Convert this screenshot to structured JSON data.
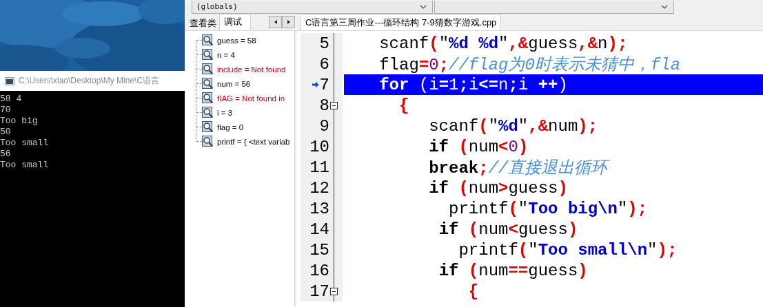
{
  "console": {
    "title": "C:\\Users\\xiao\\Desktop\\My Mine\\C语言",
    "lines": [
      "58 4",
      "70",
      "Too big",
      "50",
      "Too small",
      "56",
      "Too small"
    ]
  },
  "toolbar": {
    "scope": "(globals)"
  },
  "panel_tabs": [
    {
      "label": "查看类",
      "selected": false
    },
    {
      "label": "调试",
      "selected": true
    }
  ],
  "watch_items": [
    {
      "text": "guess = 58",
      "color": "#000000"
    },
    {
      "text": "n = 4",
      "color": "#000000"
    },
    {
      "text": "include = Not found",
      "color": "#d0021b"
    },
    {
      "text": "num = 56",
      "color": "#000000"
    },
    {
      "text": "fIAG = Not found in",
      "color": "#d0021b"
    },
    {
      "text": "i = 3",
      "color": "#000000"
    },
    {
      "text": "flag = 0",
      "color": "#000000"
    },
    {
      "text": "printf = { <text variab",
      "color": "#000000"
    }
  ],
  "editor_tabs": [
    {
      "label": "C语言第三周作业---循环结构 7-9猜数字游戏.cpp",
      "selected": true
    }
  ],
  "code_lines": [
    {
      "number": "5",
      "current": false,
      "foldable": false,
      "tokens": [
        {
          "text": "   scanf",
          "kind": "plain"
        },
        {
          "text": "(",
          "kind": "sym"
        },
        {
          "text": "\"",
          "kind": "plain"
        },
        {
          "text": "%d %d",
          "kind": "str"
        },
        {
          "text": "\"",
          "kind": "plain"
        },
        {
          "text": ",&",
          "kind": "sym"
        },
        {
          "text": "guess",
          "kind": "plain"
        },
        {
          "text": ",&",
          "kind": "sym"
        },
        {
          "text": "n",
          "kind": "plain"
        },
        {
          "text": ");",
          "kind": "sym"
        }
      ]
    },
    {
      "number": "6",
      "current": false,
      "foldable": false,
      "tokens": [
        {
          "text": "   flag",
          "kind": "plain"
        },
        {
          "text": "=",
          "kind": "sym"
        },
        {
          "text": "0",
          "kind": "num"
        },
        {
          "text": ";",
          "kind": "sym"
        },
        {
          "text": "//flag为0时表示未猜中，fla",
          "kind": "cmt"
        }
      ]
    },
    {
      "number": "7",
      "current": true,
      "foldable": false,
      "tokens": [
        {
          "text": "   for",
          "kind": "kw"
        },
        {
          "text": " (i",
          "kind": "plain"
        },
        {
          "text": "=",
          "kind": "sym"
        },
        {
          "text": "1",
          "kind": "num"
        },
        {
          "text": ";",
          "kind": "sym"
        },
        {
          "text": "i",
          "kind": "plain"
        },
        {
          "text": "<=",
          "kind": "sym"
        },
        {
          "text": "n",
          "kind": "plain"
        },
        {
          "text": ";",
          "kind": "sym"
        },
        {
          "text": "i ",
          "kind": "plain"
        },
        {
          "text": "++",
          "kind": "sym"
        },
        {
          "text": ")",
          "kind": "plain"
        }
      ]
    },
    {
      "number": "8",
      "current": false,
      "foldable": true,
      "tokens": [
        {
          "text": "     {",
          "kind": "sym"
        }
      ]
    },
    {
      "number": "9",
      "current": false,
      "foldable": false,
      "tokens": [
        {
          "text": "        scanf",
          "kind": "plain"
        },
        {
          "text": "(",
          "kind": "sym"
        },
        {
          "text": "\"",
          "kind": "plain"
        },
        {
          "text": "%d",
          "kind": "str"
        },
        {
          "text": "\"",
          "kind": "plain"
        },
        {
          "text": ",&",
          "kind": "sym"
        },
        {
          "text": "num",
          "kind": "plain"
        },
        {
          "text": ");",
          "kind": "sym"
        }
      ]
    },
    {
      "number": "10",
      "current": false,
      "foldable": false,
      "tokens": [
        {
          "text": "        if",
          "kind": "kw"
        },
        {
          "text": " (",
          "kind": "sym"
        },
        {
          "text": "num",
          "kind": "plain"
        },
        {
          "text": "<",
          "kind": "sym"
        },
        {
          "text": "0",
          "kind": "num"
        },
        {
          "text": ")",
          "kind": "sym"
        }
      ]
    },
    {
      "number": "11",
      "current": false,
      "foldable": false,
      "tokens": [
        {
          "text": "        break",
          "kind": "kw"
        },
        {
          "text": ";",
          "kind": "sym"
        },
        {
          "text": "//直接退出循环",
          "kind": "cmt"
        }
      ]
    },
    {
      "number": "12",
      "current": false,
      "foldable": false,
      "tokens": [
        {
          "text": "        if",
          "kind": "kw"
        },
        {
          "text": " (",
          "kind": "sym"
        },
        {
          "text": "num",
          "kind": "plain"
        },
        {
          "text": ">",
          "kind": "sym"
        },
        {
          "text": "guess",
          "kind": "plain"
        },
        {
          "text": ")",
          "kind": "sym"
        }
      ]
    },
    {
      "number": "13",
      "current": false,
      "foldable": false,
      "tokens": [
        {
          "text": "          printf",
          "kind": "plain"
        },
        {
          "text": "(",
          "kind": "sym"
        },
        {
          "text": "\"",
          "kind": "plain"
        },
        {
          "text": "Too big\\n",
          "kind": "str"
        },
        {
          "text": "\"",
          "kind": "plain"
        },
        {
          "text": ");",
          "kind": "sym"
        }
      ]
    },
    {
      "number": "14",
      "current": false,
      "foldable": false,
      "tokens": [
        {
          "text": "         if",
          "kind": "kw"
        },
        {
          "text": " (",
          "kind": "sym"
        },
        {
          "text": "num",
          "kind": "plain"
        },
        {
          "text": "<",
          "kind": "sym"
        },
        {
          "text": "guess",
          "kind": "plain"
        },
        {
          "text": ")",
          "kind": "sym"
        }
      ]
    },
    {
      "number": "15",
      "current": false,
      "foldable": false,
      "tokens": [
        {
          "text": "           printf",
          "kind": "plain"
        },
        {
          "text": "(",
          "kind": "sym"
        },
        {
          "text": "\"",
          "kind": "plain"
        },
        {
          "text": "Too small\\n",
          "kind": "str"
        },
        {
          "text": "\"",
          "kind": "plain"
        },
        {
          "text": ");",
          "kind": "sym"
        }
      ]
    },
    {
      "number": "16",
      "current": false,
      "foldable": false,
      "tokens": [
        {
          "text": "         if",
          "kind": "kw"
        },
        {
          "text": " (",
          "kind": "sym"
        },
        {
          "text": "num",
          "kind": "plain"
        },
        {
          "text": "==",
          "kind": "sym"
        },
        {
          "text": "guess",
          "kind": "plain"
        },
        {
          "text": ")",
          "kind": "sym"
        }
      ]
    },
    {
      "number": "17",
      "current": false,
      "foldable": true,
      "tokens": [
        {
          "text": "            {",
          "kind": "sym"
        }
      ]
    }
  ]
}
